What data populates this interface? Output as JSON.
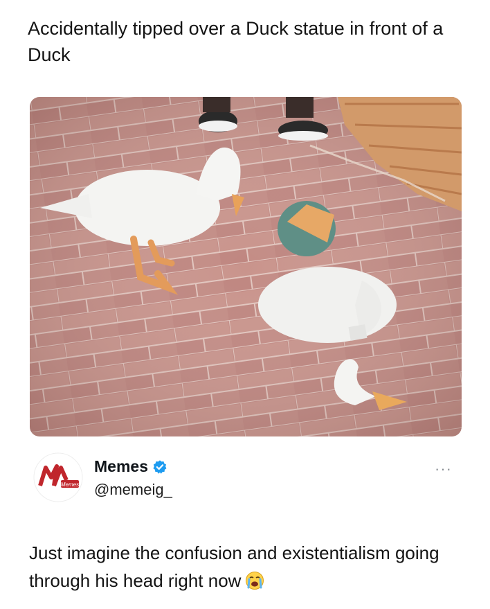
{
  "post": {
    "caption": "Accidentally tipped over a Duck statue in front of a Duck",
    "image_icon": "photo-of-duck-and-broken-duck-statue"
  },
  "author": {
    "name": "Memes",
    "handle": "@memeig_",
    "avatar_icon": "memes-logo-icon",
    "avatar_text": "Memes",
    "verified_icon": "verified-badge-icon"
  },
  "menu": {
    "label": "···"
  },
  "tweet": {
    "text": "Just imagine the confusion and existentialism going through his head right now",
    "emoji_icon": "crying-face-emoji-icon"
  },
  "colors": {
    "verified": "#1d9bf0",
    "brand_red": "#c0262c"
  }
}
